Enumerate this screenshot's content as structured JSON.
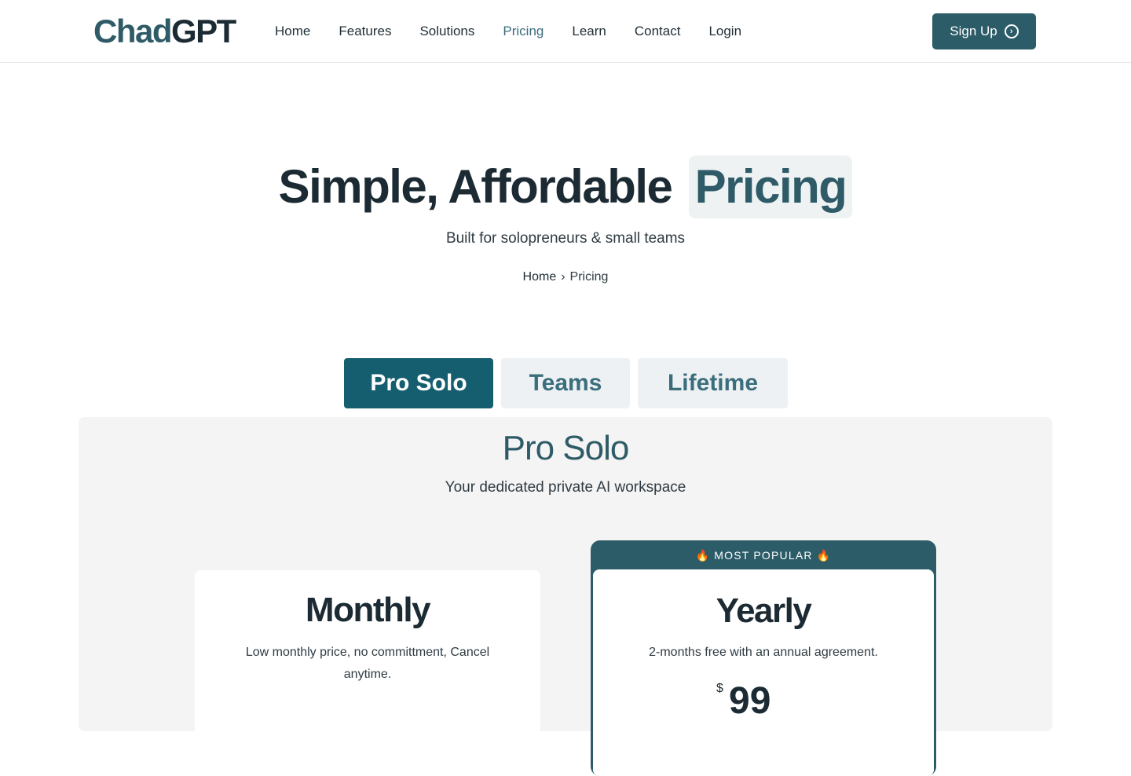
{
  "header": {
    "logo_part1": "Chad",
    "logo_part2": "GPT",
    "nav": [
      "Home",
      "Features",
      "Solutions",
      "Pricing",
      "Learn",
      "Contact",
      "Login"
    ],
    "signup_label": "Sign Up"
  },
  "hero": {
    "title_part1": "Simple, Affordable",
    "title_highlight": "Pricing",
    "subtitle": "Built for solopreneurs & small teams",
    "breadcrumb_home": "Home",
    "breadcrumb_separator": "›",
    "breadcrumb_current": "Pricing"
  },
  "tabs": [
    "Pro Solo",
    "Teams",
    "Lifetime"
  ],
  "panel": {
    "title": "Pro Solo",
    "subtitle": "Your dedicated private AI workspace"
  },
  "plans": {
    "monthly": {
      "title": "Monthly",
      "description": "Low monthly price, no committment, Cancel anytime."
    },
    "yearly": {
      "badge": "MOST POPULAR",
      "badge_icon": "🔥",
      "title": "Yearly",
      "description": "2-months free with an annual agreement.",
      "currency": "$",
      "price": "99"
    }
  },
  "colors": {
    "brand": "#2c5c68",
    "active_tab": "#155e70",
    "inactive_tab_bg": "#eef1f3"
  }
}
